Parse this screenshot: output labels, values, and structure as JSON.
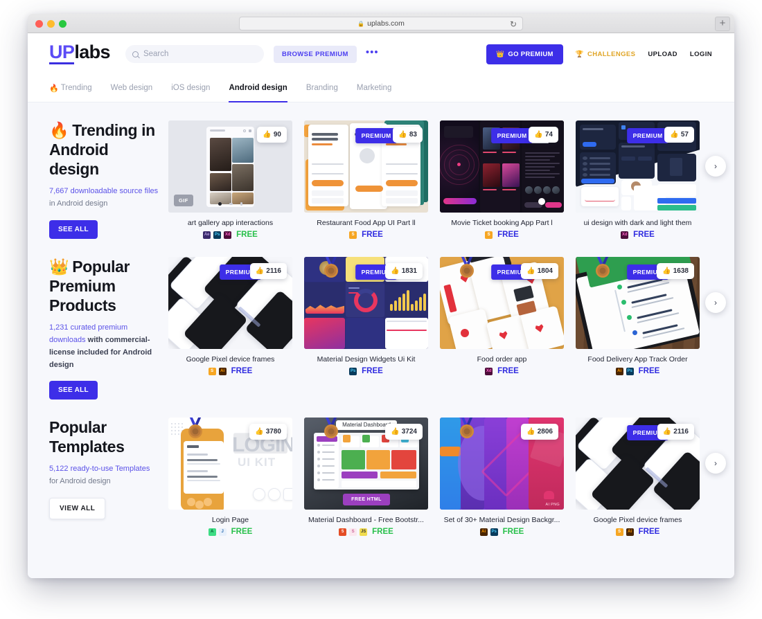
{
  "browser": {
    "url": "uplabs.com",
    "lock_icon": "lock-icon",
    "reload_icon": "reload-icon",
    "newtab_label": "+"
  },
  "header": {
    "logo_up": "UP",
    "logo_labs": "labs",
    "search_placeholder": "Search",
    "search_value": "",
    "browse_premium": "BROWSE PREMIUM",
    "more_dots": "•••",
    "go_premium": "GO PREMIUM",
    "go_premium_icon": "crown-icon",
    "challenges": "CHALLENGES",
    "challenges_icon": "trophy-icon",
    "upload": "UPLOAD",
    "login": "LOGIN",
    "accent": "#3d2ee8",
    "challenges_color": "#e0a526"
  },
  "tabs": [
    {
      "label": "Trending",
      "icon": "fire-icon",
      "active": false
    },
    {
      "label": "Web design",
      "icon": "",
      "active": false
    },
    {
      "label": "iOS design",
      "icon": "",
      "active": false
    },
    {
      "label": "Android design",
      "icon": "",
      "active": true
    },
    {
      "label": "Branding",
      "icon": "",
      "active": false
    },
    {
      "label": "Marketing",
      "icon": "",
      "active": false
    }
  ],
  "sections": [
    {
      "emoji": "🔥",
      "title": "Trending in Android design",
      "sub_hl": "7,667 downloadable source files",
      "sub_rest": " in Android design",
      "cta": "SEE ALL",
      "cta_style": "primary",
      "cards": [
        {
          "title": "art gallery app interactions",
          "likes": "90",
          "premium": false,
          "gif": "GIF",
          "medal": false,
          "free_label": "FREE",
          "free_color": "#27c04a",
          "tags": [
            {
              "name": "Ae",
              "bg": "#3a2a6b",
              "fg": "#b39ddb"
            },
            {
              "name": "Ps",
              "bg": "#083b5c",
              "fg": "#49c8f5"
            },
            {
              "name": "Xd",
              "bg": "#4d0d3a",
              "fg": "#ff61c7"
            }
          ],
          "art": "gallery"
        },
        {
          "title": "Restaurant Food App UI Part ll",
          "likes": "83",
          "premium": true,
          "premium_label": "PREMIUM",
          "gif": "",
          "medal": false,
          "free_label": "FREE",
          "free_color": "#2f2be0",
          "tags": [
            {
              "name": "S",
              "bg": "#f6a623",
              "fg": "#ffffff"
            }
          ],
          "art": "restaurant"
        },
        {
          "title": "Movie Ticket booking App Part l",
          "likes": "74",
          "premium": true,
          "premium_label": "PREMIUM",
          "gif": "",
          "medal": false,
          "free_label": "FREE",
          "free_color": "#2f2be0",
          "tags": [
            {
              "name": "S",
              "bg": "#f6a623",
              "fg": "#ffffff"
            }
          ],
          "art": "movie"
        },
        {
          "title": "ui design with dark and light them",
          "likes": "57",
          "premium": true,
          "premium_label": "PREMIUM",
          "gif": "",
          "medal": false,
          "free_label": "FREE",
          "free_color": "#2f2be0",
          "tags": [
            {
              "name": "Xd",
              "bg": "#4d0d3a",
              "fg": "#ff61c7"
            }
          ],
          "art": "uikit"
        }
      ]
    },
    {
      "emoji": "👑",
      "title": "Popular Premium Products",
      "sub_hl": "1,231 curated premium downloads",
      "sub_rest": " with commercial-license included for Android design",
      "cta": "SEE ALL",
      "cta_style": "primary",
      "cards": [
        {
          "title": "Google Pixel device frames",
          "likes": "2116",
          "premium": true,
          "premium_label": "PREMIUM",
          "gif": "",
          "medal": false,
          "free_label": "FREE",
          "free_color": "#2f2be0",
          "tags": [
            {
              "name": "S",
              "bg": "#f6a623",
              "fg": "#ffffff"
            },
            {
              "name": "Ai",
              "bg": "#4a2500",
              "fg": "#ff9a00"
            }
          ],
          "art": "pixel"
        },
        {
          "title": "Material Design Widgets Ui Kit",
          "likes": "1831",
          "premium": true,
          "premium_label": "PREMIUM",
          "gif": "",
          "medal": true,
          "free_label": "FREE",
          "free_color": "#2f2be0",
          "tags": [
            {
              "name": "Ps",
              "bg": "#083b5c",
              "fg": "#49c8f5"
            }
          ],
          "art": "widgets"
        },
        {
          "title": "Food order app",
          "likes": "1804",
          "premium": true,
          "premium_label": "PREMIUM",
          "gif": "",
          "medal": true,
          "free_label": "FREE",
          "free_color": "#2f2be0",
          "tags": [
            {
              "name": "Xd",
              "bg": "#4d0d3a",
              "fg": "#ff61c7"
            }
          ],
          "art": "foodorder"
        },
        {
          "title": "Food Delivery App Track Order",
          "likes": "1638",
          "premium": true,
          "premium_label": "PREMIUM",
          "gif": "",
          "medal": true,
          "free_label": "FREE",
          "free_color": "#2f2be0",
          "tags": [
            {
              "name": "Ai",
              "bg": "#4a2500",
              "fg": "#ff9a00"
            },
            {
              "name": "Ps",
              "bg": "#083b5c",
              "fg": "#49c8f5"
            }
          ],
          "art": "delivery"
        }
      ]
    },
    {
      "emoji": "",
      "title": "Popular Templates",
      "sub_hl": "5,122 ready-to-use Templates",
      "sub_rest": " for Android design",
      "cta": "VIEW ALL",
      "cta_style": "outline",
      "cards": [
        {
          "title": "Login Page",
          "likes": "3780",
          "premium": false,
          "gif": "",
          "medal": true,
          "free_label": "FREE",
          "free_color": "#27c04a",
          "tags": [
            {
              "name": "A",
              "bg": "#3ddc84",
              "fg": "#0b5c34"
            },
            {
              "name": "J",
              "bg": "#e8f0fb",
              "fg": "#2b6cb0"
            }
          ],
          "art": "loginpage"
        },
        {
          "title": "Material Dashboard - Free Bootstr...",
          "likes": "3724",
          "premium": false,
          "gif": "",
          "medal": true,
          "free_label": "FREE",
          "free_color": "#27c04a",
          "tags": [
            {
              "name": "5",
              "bg": "#e44d26",
              "fg": "#ffffff"
            },
            {
              "name": "S",
              "bg": "#fbe7ef",
              "fg": "#cd6799"
            },
            {
              "name": "JS",
              "bg": "#f0db4f",
              "fg": "#333333"
            }
          ],
          "art": "dashboard"
        },
        {
          "title": "Set of 30+ Material Design Backgr...",
          "likes": "2806",
          "premium": false,
          "gif": "",
          "medal": true,
          "free_label": "FREE",
          "free_color": "#27c04a",
          "tags": [
            {
              "name": "Ai",
              "bg": "#4a2500",
              "fg": "#ff9a00"
            },
            {
              "name": "Ps",
              "bg": "#083b5c",
              "fg": "#49c8f5"
            }
          ],
          "art": "backgrounds"
        },
        {
          "title": "Google Pixel device frames",
          "likes": "2116",
          "premium": true,
          "premium_label": "PREMIUM",
          "gif": "",
          "medal": false,
          "free_label": "FREE",
          "free_color": "#2f2be0",
          "tags": [
            {
              "name": "S",
              "bg": "#f6a623",
              "fg": "#ffffff"
            },
            {
              "name": "Ai",
              "bg": "#4a2500",
              "fg": "#ff9a00"
            }
          ],
          "art": "pixel"
        }
      ]
    }
  ],
  "carousel_next_icon": "chevron-right-icon"
}
